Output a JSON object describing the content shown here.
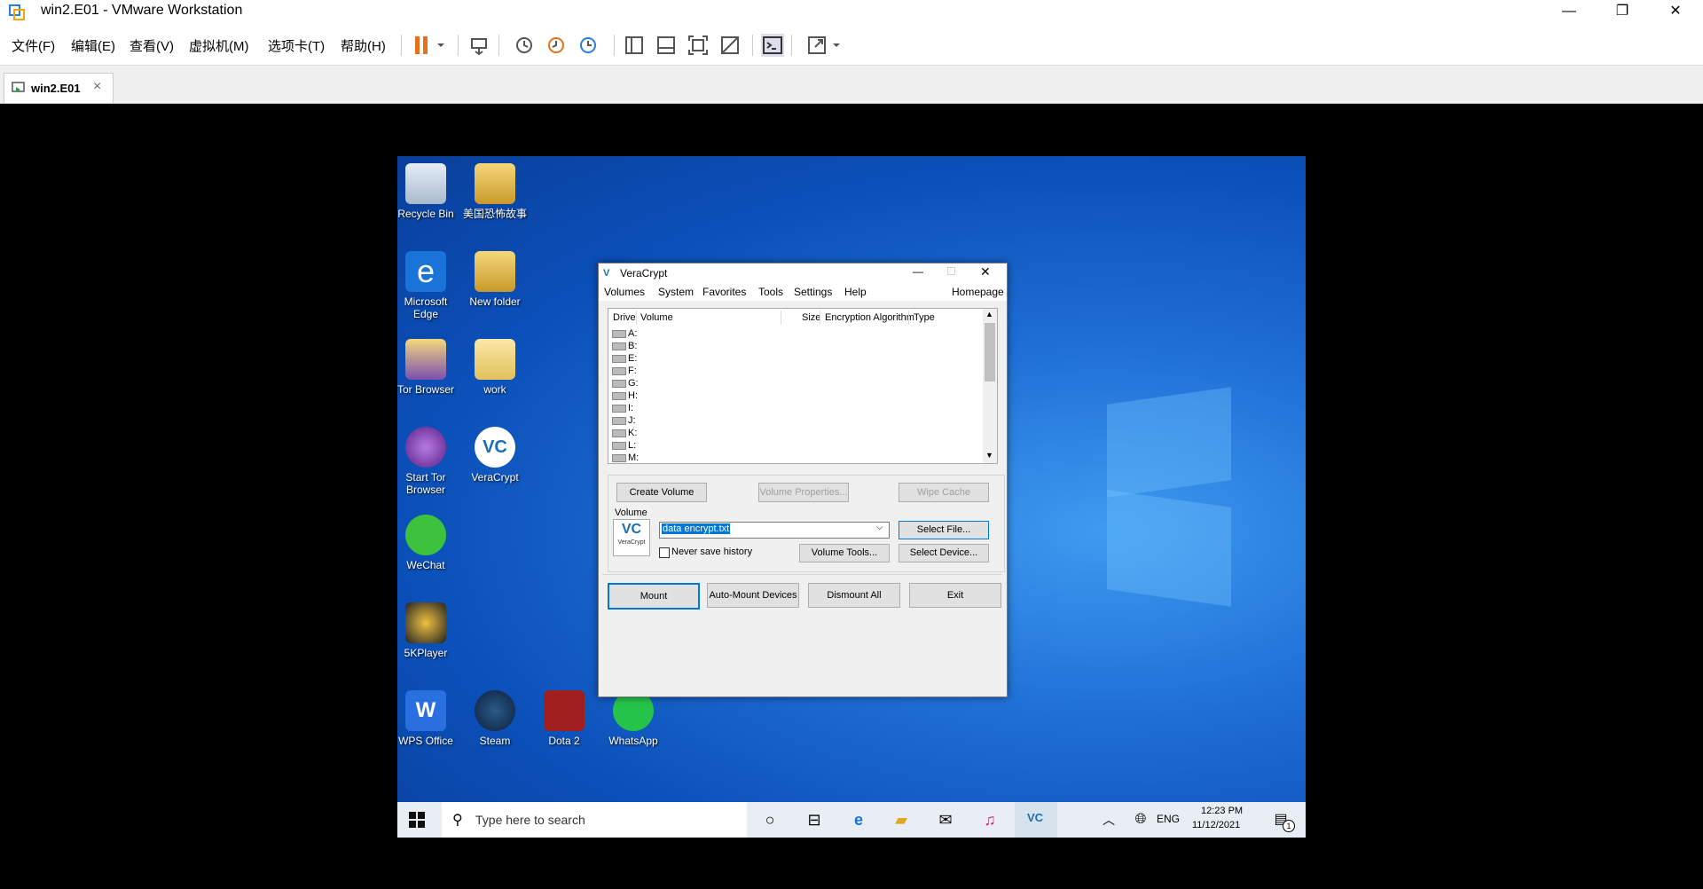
{
  "app": {
    "title": "win2.E01 - VMware Workstation"
  },
  "menubar": {
    "items": [
      "文件(F)",
      "编辑(E)",
      "查看(V)",
      "虚拟机(M)",
      "选项卡(T)",
      "帮助(H)"
    ]
  },
  "tab": {
    "label": "win2.E01"
  },
  "desktop": {
    "icons": [
      {
        "label": "Recycle Bin"
      },
      {
        "label": "美国恐怖故事"
      },
      {
        "label": "Microsoft Edge"
      },
      {
        "label": "New folder"
      },
      {
        "label": "Tor Browser"
      },
      {
        "label": "work"
      },
      {
        "label": "Start Tor Browser"
      },
      {
        "label": "VeraCrypt"
      },
      {
        "label": "WeChat"
      },
      {
        "label": "5KPlayer"
      },
      {
        "label": "WPS Office"
      },
      {
        "label": "Steam"
      },
      {
        "label": "Dota 2"
      },
      {
        "label": "WhatsApp"
      }
    ]
  },
  "veracrypt": {
    "title": "VeraCrypt",
    "menu": [
      "Volumes",
      "System",
      "Favorites",
      "Tools",
      "Settings",
      "Help"
    ],
    "homepage": "Homepage",
    "columns": [
      "Drive",
      "Volume",
      "Size",
      "Encryption Algorithm",
      "Type"
    ],
    "drives": [
      "A:",
      "B:",
      "E:",
      "F:",
      "G:",
      "H:",
      "I:",
      "J:",
      "K:",
      "L:",
      "M:"
    ],
    "buttons": {
      "create_volume": "Create Volume",
      "volume_properties": "Volume Properties...",
      "wipe_cache": "Wipe Cache",
      "select_file": "Select File...",
      "volume_tools": "Volume Tools...",
      "select_device": "Select Device...",
      "mount": "Mount",
      "auto_mount": "Auto-Mount Devices",
      "dismount_all": "Dismount All",
      "exit": "Exit"
    },
    "volume_label": "Volume",
    "volume_value": "data encrypt.txt",
    "never_save_history": "Never save history",
    "logo_text": "VeraCrypt"
  },
  "taskbar": {
    "search_placeholder": "Type here to search",
    "lang": "ENG",
    "time": "12:23 PM",
    "date": "11/12/2021",
    "notification_count": "1"
  },
  "colors": {
    "desktop_blue": "#0b4fb8",
    "accent": "#0078d7"
  }
}
